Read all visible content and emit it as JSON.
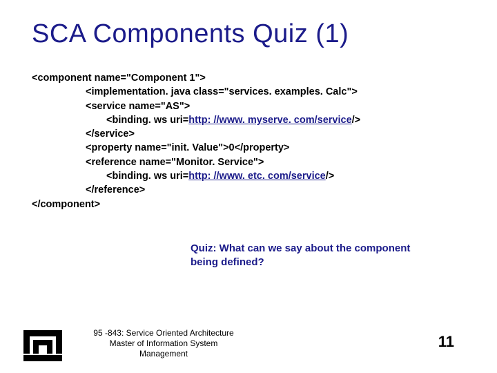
{
  "title": "SCA Components Quiz (1)",
  "code": {
    "l1": "<component name=\"Component 1\">",
    "l2": "<implementation. java class=\"services. examples. Calc\">",
    "l3": "<service name=\"AS\">",
    "l4a": "<binding. ws uri=",
    "l4link": "http: //www. myserve. com/service",
    "l4b": "/>",
    "l5": "</service>",
    "l6": "<property name=\"init. Value\">0</property>",
    "l7": "<reference name=\"Monitor. Service\">",
    "l8a": "<binding. ws uri=",
    "l8link": "http: //www. etc. com/service",
    "l8b": "/>",
    "l9": "</reference>",
    "l10": "</component>"
  },
  "quiz": {
    "line1": "Quiz: What can we say about the component",
    "line2": "being defined?"
  },
  "footer": {
    "course": "95 -843: Service Oriented Architecture",
    "dept1": "Master of Information System",
    "dept2": "Management"
  },
  "page": "11"
}
